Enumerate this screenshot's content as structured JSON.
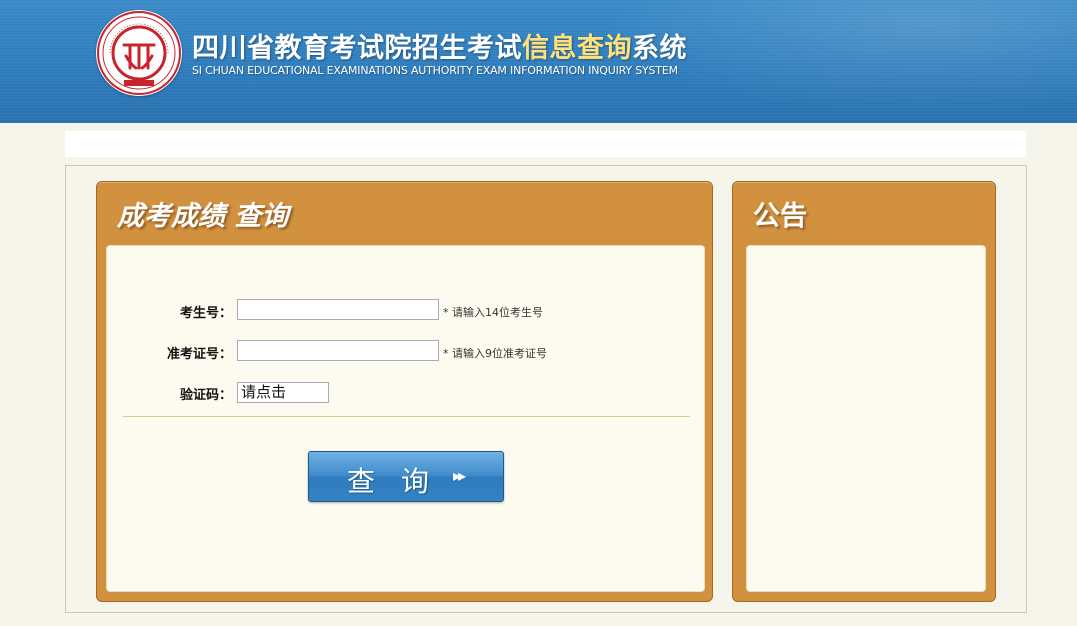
{
  "header": {
    "logo_text": "四川省教育考试院",
    "title_cn_prefix": "四川省教育考试院招生考试",
    "title_cn_highlight": "信息查询",
    "title_cn_suffix": "系统",
    "title_en": "SI CHUAN EDUCATIONAL EXAMINATIONS AUTHORITY EXAM INFORMATION INQUIRY SYSTEM"
  },
  "query_panel": {
    "title": "成考成绩  查询",
    "fields": [
      {
        "label": "考生号：",
        "value": "",
        "placeholder": "",
        "hint": "* 请输入14位考生号"
      },
      {
        "label": "准考证号：",
        "value": "",
        "placeholder": "",
        "hint": "* 请输入9位准考证号"
      }
    ],
    "captcha": {
      "label": "验证码：",
      "value": "请点击"
    },
    "submit_label": "查询",
    "submit_icon": "double-chevron-right-icon"
  },
  "notice_panel": {
    "title": "公告"
  },
  "colors": {
    "header_blue": "#2f7dbd",
    "title_highlight": "#ffe07a",
    "panel_orange": "#d2913f",
    "panel_inner": "#fdfbef",
    "button_blue": "#3383c4",
    "logo_red": "#c8242b"
  }
}
